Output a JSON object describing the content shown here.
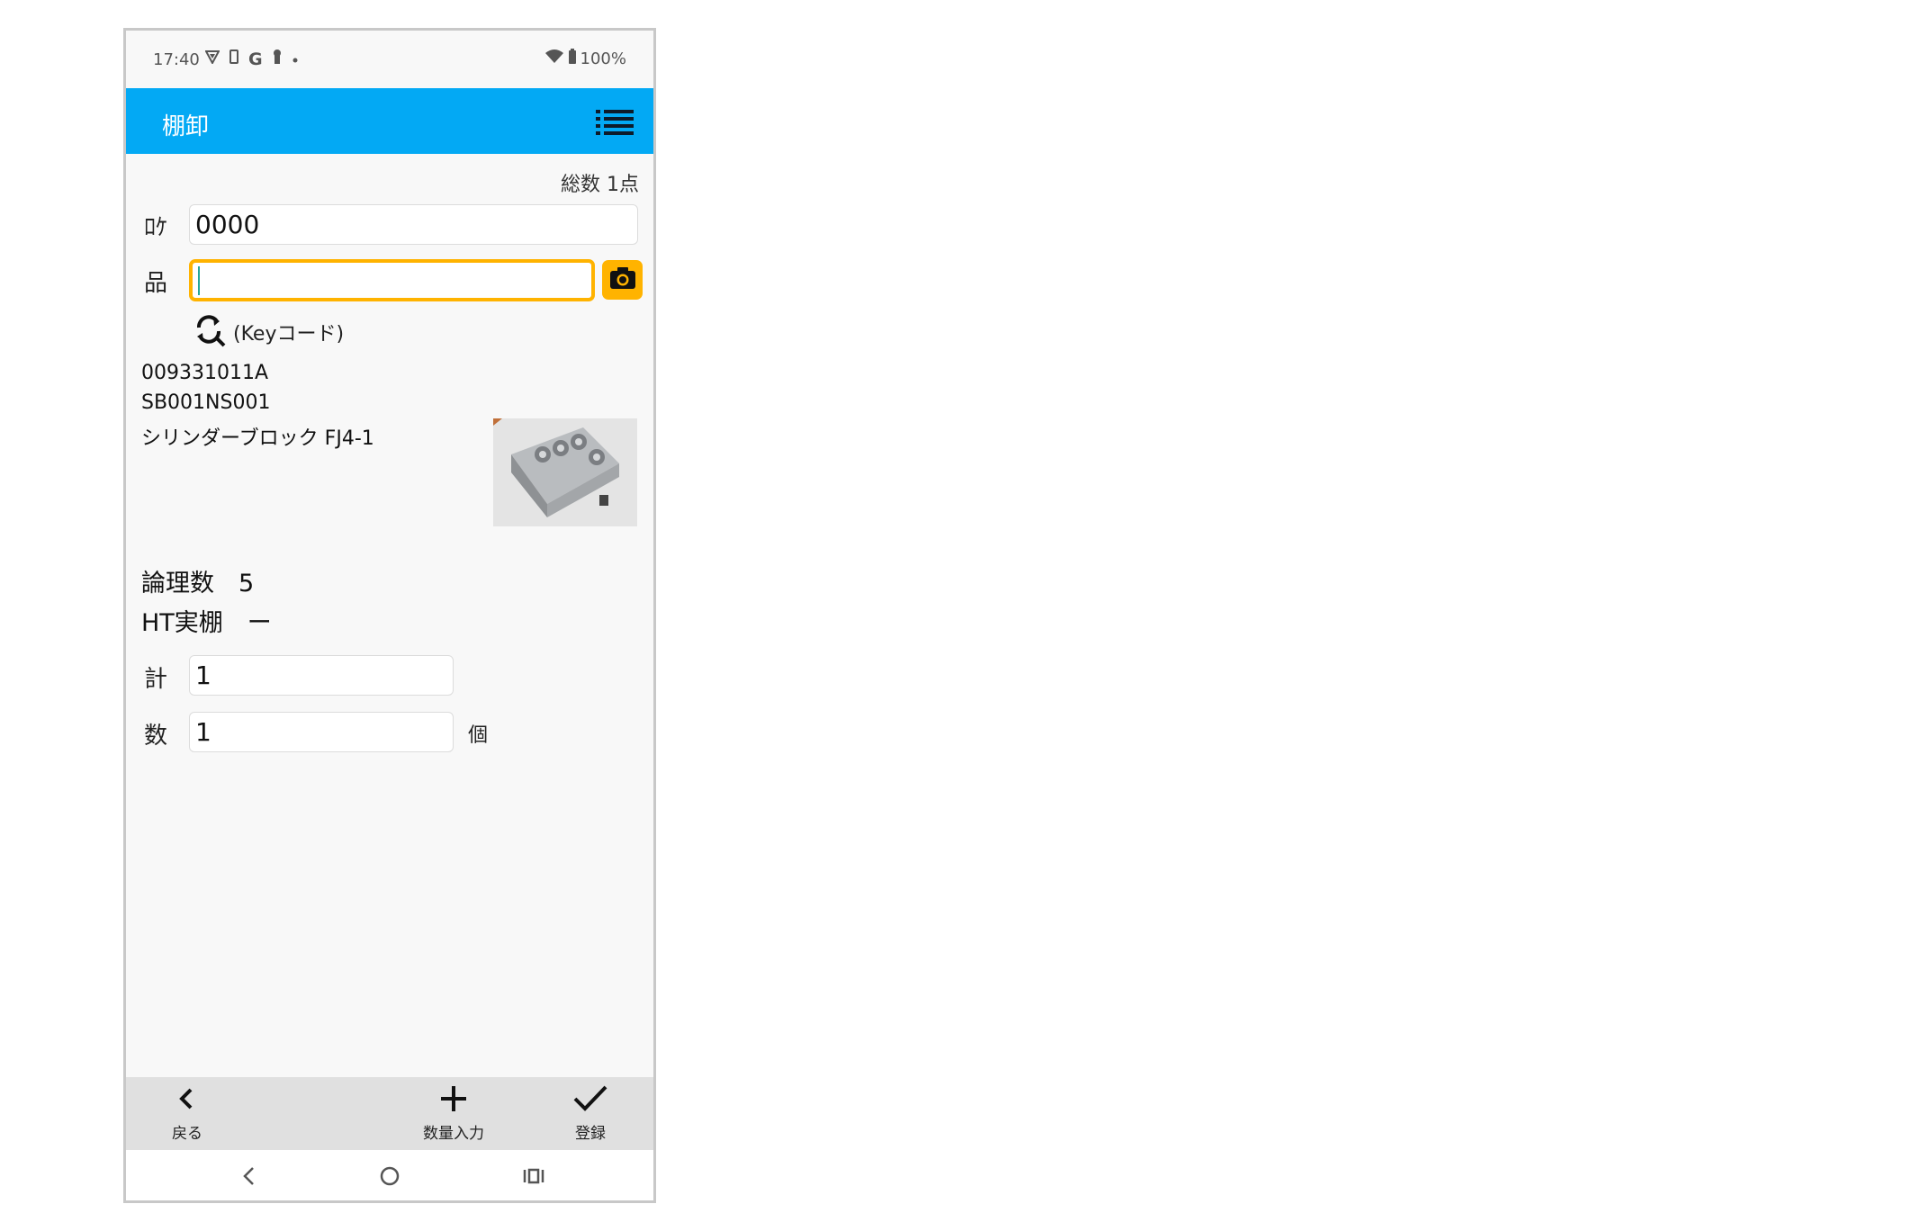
{
  "status_bar": {
    "time": "17:40",
    "left_icons": [
      "vpn-icon",
      "sim-icon",
      "google-icon",
      "keyhole-icon",
      "dot-icon"
    ],
    "battery": "100%"
  },
  "app_bar": {
    "title": "棚卸",
    "menu_icon": "list-menu-icon",
    "color": "#03a9f4"
  },
  "summary": {
    "total": "総数 1点"
  },
  "form": {
    "location": {
      "label": "ﾛｹ",
      "value": "0000"
    },
    "item": {
      "label": "品",
      "value": "",
      "accent": "#ffb300"
    },
    "search": {
      "label": "(Keyコード)"
    }
  },
  "product": {
    "code": "009331011A",
    "part_no": "SB001NS001",
    "name": "シリンダーブロック FJ4-1"
  },
  "stats": {
    "logical": "論理数　5",
    "ht_actual": "HT実棚　ー"
  },
  "counts": {
    "total_label": "計",
    "total_value": "1",
    "qty_label": "数",
    "qty_value": "1",
    "unit": "個"
  },
  "actions": {
    "back": "戻る",
    "qty_input": "数量入力",
    "register": "登録"
  },
  "nav": {
    "icons": [
      "back-nav-icon",
      "home-nav-icon",
      "recents-nav-icon"
    ]
  }
}
